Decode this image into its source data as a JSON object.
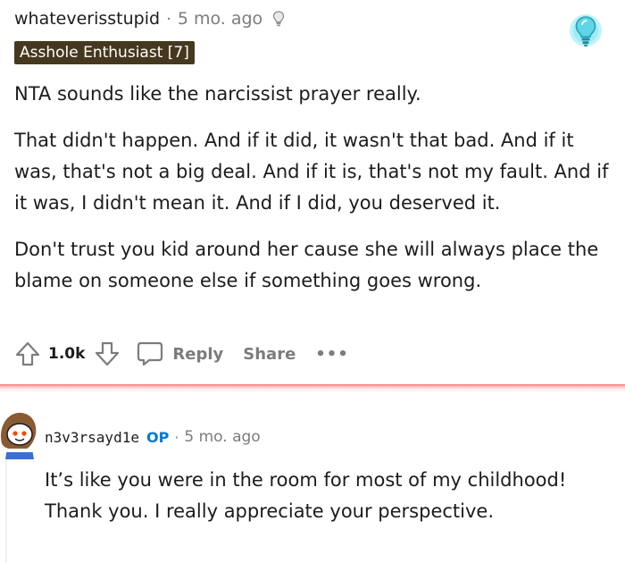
{
  "comment": {
    "username": "whateverisstupid",
    "separator": "·",
    "timestamp": "5 mo. ago",
    "flair": "Asshole Enthusiast [7]",
    "paragraphs": [
      "NTA sounds like the narcissist prayer really.",
      "That didn't happen. And if it did, it wasn't that bad. And if it was, that's not a big deal. And if it is, that's not my fault. And if it was, I didn't mean it. And if I did, you deserved it.",
      "Don't trust you kid around her cause she will always place the blame on someone else if something goes wrong."
    ],
    "actions": {
      "upvote_icon": "arrow-up-icon",
      "score": "1.0k",
      "downvote_icon": "arrow-down-icon",
      "reply_icon": "speech-bubble-icon",
      "reply_label": "Reply",
      "share_label": "Share",
      "more_label": "•••"
    },
    "award_icon": "lightbulb-award-icon"
  },
  "reply": {
    "username": "n3v3rsayd1e",
    "op_badge": "OP",
    "separator": "·",
    "timestamp": "5 mo. ago",
    "body": "It’s like you were in the room for most of my childhood! Thank you. I really appreciate your perspective."
  },
  "colors": {
    "flair_bg": "#46381f",
    "op_blue": "#0079d3",
    "meta_gray": "#7c7c7c",
    "divider_red": "#ff6a6a"
  }
}
